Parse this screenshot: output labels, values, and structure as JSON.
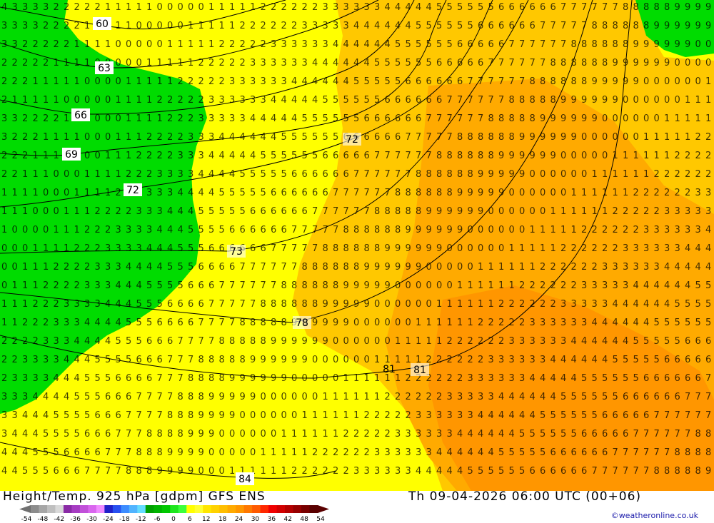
{
  "title": "Height/Temp. 925 hPa [gdpm] GFS ENS",
  "valid_time": "Th 09-04-2026 06:00 UTC (00+06)",
  "credit": "©weatheronline.co.uk",
  "contour_labels": [
    "60",
    "63",
    "66",
    "69",
    "72",
    "72",
    "73",
    "78",
    "81",
    "81",
    "84"
  ],
  "colorbar": {
    "ticks": [
      "-54",
      "-48",
      "-42",
      "-36",
      "-30",
      "-24",
      "-18",
      "-12",
      "-6",
      "0",
      "6",
      "12",
      "18",
      "24",
      "30",
      "36",
      "42",
      "48",
      "54"
    ],
    "colors": [
      "#8c8c8c",
      "#a6a6a6",
      "#bfbfbf",
      "#d9d9d9",
      "#8a2ba6",
      "#a63cc2",
      "#c150d9",
      "#d966ee",
      "#f08cff",
      "#2020c8",
      "#2850f0",
      "#3c8cff",
      "#50b4ff",
      "#64dcff",
      "#00a000",
      "#00b400",
      "#00c800",
      "#1ee61e",
      "#3cff3c",
      "#ffff00",
      "#ffff32",
      "#ffe600",
      "#ffd200",
      "#ffbe00",
      "#ffaa00",
      "#ff9600",
      "#ff7800",
      "#ff5a00",
      "#ff2800",
      "#f00000",
      "#d20000",
      "#b40000",
      "#960000",
      "#780000",
      "#5a0000"
    ]
  },
  "field_colors": {
    "green": "#00dc00",
    "yellow": "#ffff00",
    "light_orange": "#ffc800",
    "orange": "#ffaa00",
    "dark_orange": "#ff9600"
  }
}
